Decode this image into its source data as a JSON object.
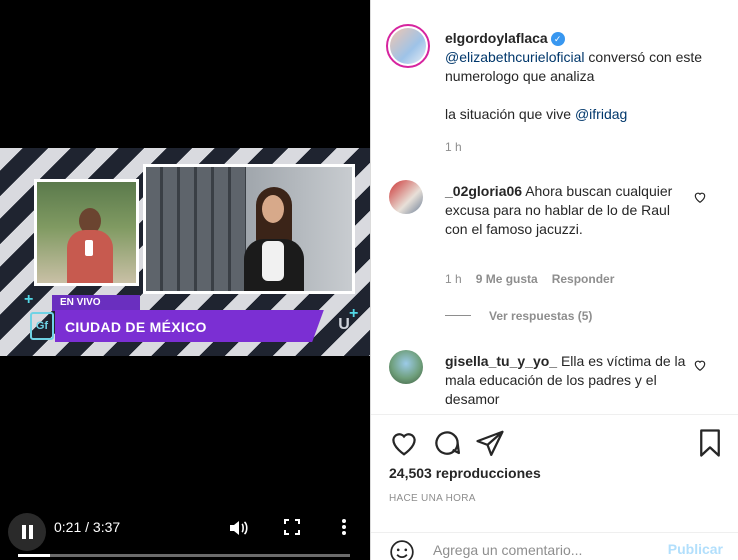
{
  "video": {
    "overlay": {
      "live_tag": "EN VIVO",
      "location": "CIUDAD DE MÉXICO",
      "channel_logo": "Gf",
      "network_logo": "U"
    },
    "time_current": "0:21",
    "time_total": "3:37",
    "progress": 0.097
  },
  "post": {
    "account": "elgordoylaflaca",
    "verified": true,
    "caption_mention": "@elizabethcurieloficial",
    "caption_text_1": " conversó con este numerologo que analiza",
    "caption_text_2": "la situación que vive ",
    "caption_mention_2": "@ifridag",
    "caption_age": "1 h"
  },
  "comments": [
    {
      "user": "_02gloria06",
      "text": "Ahora buscan cualquier excusa para no hablar de lo de Raul con el famoso jacuzzi.",
      "age": "1 h",
      "likes": "9 Me gusta",
      "reply": "Responder",
      "view_replies": "Ver respuestas (5)"
    },
    {
      "user": "gisella_tu_y_yo_",
      "text": "Ella es víctima de la mala educación de los padres y el desamor"
    }
  ],
  "stats": {
    "views": "24,503 reproducciones",
    "posted": "HACE UNA HORA"
  },
  "composer": {
    "placeholder": "Agrega un comentario...",
    "publish": "Publicar"
  },
  "icons": {
    "like": "heart-icon",
    "comment": "comment-icon",
    "share": "share-icon",
    "save": "bookmark-icon",
    "emoji": "emoji-icon"
  }
}
